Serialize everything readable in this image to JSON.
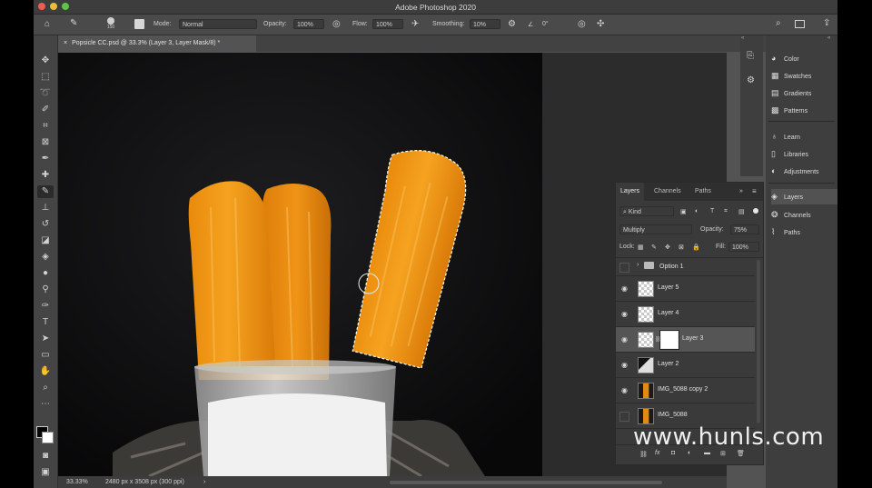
{
  "app": {
    "title": "Adobe Photoshop 2020"
  },
  "options_bar": {
    "brush_size": "150",
    "mode_label": "Mode:",
    "mode_value": "Normal",
    "opacity_label": "Opacity:",
    "opacity_value": "100%",
    "flow_label": "Flow:",
    "flow_value": "100%",
    "smoothing_label": "Smoothing:",
    "smoothing_value": "10%",
    "angle_value": "0°"
  },
  "document_tab": {
    "label": "Popsicle CC.psd @ 33.3% (Layer 3, Layer Mask/8) *"
  },
  "status_bar": {
    "zoom": "33.33%",
    "doc_info": "2480 px x 3508 px (300 ppi)"
  },
  "right_panel": {
    "items": [
      {
        "label": "Color",
        "icon": "color-icon"
      },
      {
        "label": "Swatches",
        "icon": "swatches-icon"
      },
      {
        "label": "Gradients",
        "icon": "gradients-icon"
      },
      {
        "label": "Patterns",
        "icon": "patterns-icon"
      },
      {
        "label": "Learn",
        "icon": "learn-icon"
      },
      {
        "label": "Libraries",
        "icon": "libraries-icon"
      },
      {
        "label": "Adjustments",
        "icon": "adjustments-icon"
      },
      {
        "label": "Layers",
        "icon": "layers-icon"
      },
      {
        "label": "Channels",
        "icon": "channels-icon"
      },
      {
        "label": "Paths",
        "icon": "paths-icon"
      }
    ]
  },
  "layers_panel": {
    "tabs": [
      "Layers",
      "Channels",
      "Paths"
    ],
    "filter_kind": "Kind",
    "blend_mode": "Multiply",
    "opacity_label": "Opacity:",
    "opacity_value": "75%",
    "lock_label": "Lock:",
    "fill_label": "Fill:",
    "fill_value": "100%",
    "layers": [
      {
        "name": "Option 1",
        "type": "group",
        "visible": false
      },
      {
        "name": "Layer 5",
        "visible": true
      },
      {
        "name": "Layer 4",
        "visible": true
      },
      {
        "name": "Layer 3",
        "visible": true,
        "selected": true,
        "has_mask": true
      },
      {
        "name": "Layer 2",
        "visible": true
      },
      {
        "name": "IMG_5088 copy 2",
        "visible": true
      },
      {
        "name": "IMG_5088",
        "visible": false
      }
    ]
  },
  "watermark": {
    "text": "www.hunls.com"
  },
  "colors": {
    "popsicle": "#f29a15",
    "panel": "#3a3a3a",
    "canvas_bg": "#0c0c0d"
  }
}
